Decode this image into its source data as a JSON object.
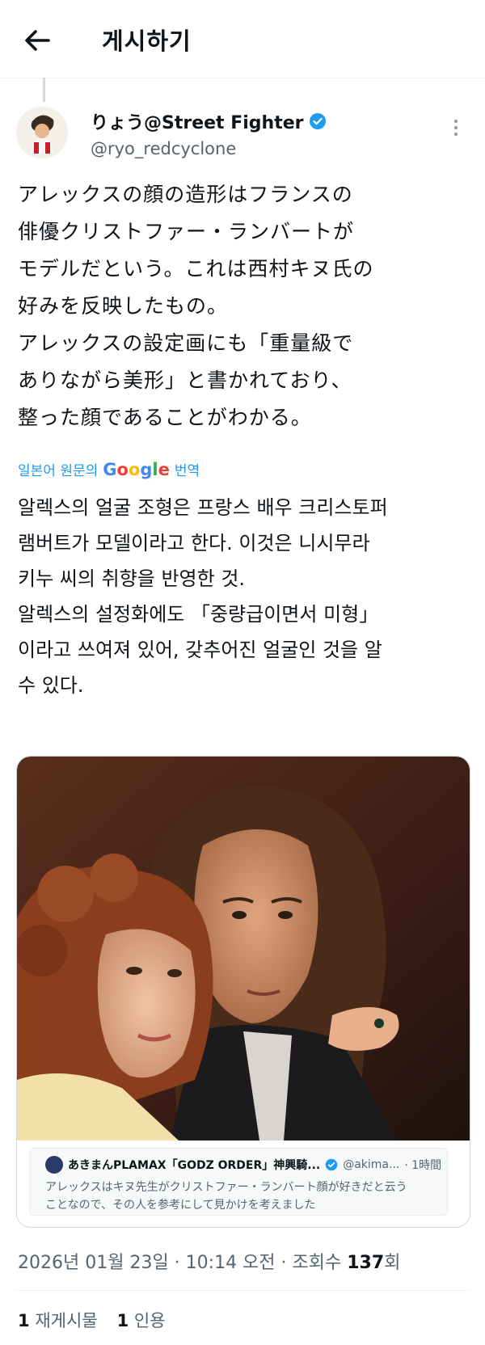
{
  "header": {
    "title": "게시하기"
  },
  "author": {
    "display_name": "りょう@Street Fighter",
    "handle": "@ryo_redcyclone",
    "verified_color": "#1d9bf0"
  },
  "post": {
    "text_jp": "アレックスの顔の造形はフランスの\n俳優クリストファー・ランバートが\nモデルだという。これは西村キヌ氏の\n好みを反映したもの。\nアレックスの設定画にも「重量級で\nありながら美形」と書かれており、\n整った顔であることがわかる。",
    "translate_prefix": "일본어 원문의",
    "translate_brand": "Google",
    "translate_suffix": "번역",
    "text_ko": "알렉스의 얼굴 조형은 프랑스 배우 크리스토퍼\n램버트가 모델이라고 한다. 이것은 니시무라\n키누 씨의 취향을 반영한 것.\n알렉스의 설정화에도 「중량급이면서 미형」\n이라고 쓰여져 있어, 갖추어진 얼굴인 것을 알\n수 있다."
  },
  "quoted": {
    "name": "あきまんPLAMAX「GODZ ORDER」神興騎...",
    "handle": "@akima...",
    "time": "· 1時間",
    "text": "アレックスはキヌ先生がクリストファー・ランバート顔が好きだと云う\nことなので、その人を参考にして見かけを考えました"
  },
  "meta": {
    "timestamp": "2026년 01월 23일 · 10:14 오전 · 조회수",
    "views": "137",
    "views_suffix": "회"
  },
  "stats": {
    "reposts_count": "1",
    "reposts_label": "재게시물",
    "quotes_count": "1",
    "quotes_label": "인용"
  },
  "icons": [
    "back-arrow-icon",
    "verified-badge-icon",
    "more-options-icon"
  ]
}
